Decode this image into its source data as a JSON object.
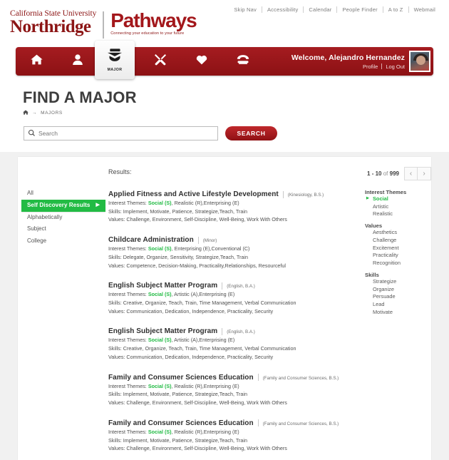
{
  "utility_nav": [
    {
      "label": "Skip Nav"
    },
    {
      "label": "Accessibility"
    },
    {
      "label": "Calendar"
    },
    {
      "label": "People Finder"
    },
    {
      "label": "A to Z"
    },
    {
      "label": "Webmail"
    }
  ],
  "logo": {
    "line1": "California State University",
    "line2": "Northridge",
    "brand": "Pathways",
    "tagline": "Connecting your education to your future"
  },
  "main_nav": {
    "icons": [
      {
        "name": "home-icon",
        "label": "Home"
      },
      {
        "name": "person-icon",
        "label": "Profile"
      },
      {
        "name": "graduation-cap-icon",
        "label": "MAJOR"
      },
      {
        "name": "tools-icon",
        "label": "Tools"
      },
      {
        "name": "heart-icon",
        "label": "Favorites"
      },
      {
        "name": "phone-icon",
        "label": "Contact"
      }
    ],
    "active_tab_label": "MAJOR",
    "welcome": "Welcome,  Alejandro Hernandez",
    "profile_link": "Profile",
    "logout_link": "Log Out"
  },
  "page": {
    "title": "FIND A MAJOR",
    "breadcrumb_home_icon": "home-icon",
    "breadcrumb_arrow": "→",
    "breadcrumb_current": "MAJORS"
  },
  "search": {
    "placeholder": "Search",
    "value": "",
    "button_label": "SEARCH",
    "icon": "search-icon"
  },
  "filters": {
    "items": [
      {
        "label": "All",
        "selected": false
      },
      {
        "label": "Self Discovery Results",
        "selected": true
      },
      {
        "label": "Alphabetically",
        "selected": false
      },
      {
        "label": "Subject",
        "selected": false
      },
      {
        "label": "College",
        "selected": false
      }
    ],
    "selected_caret": "▶"
  },
  "results": {
    "label": "Results:",
    "pagination": {
      "range": "1 - 10",
      "of": "of",
      "total": "999",
      "prev_icon": "chevron-left-icon",
      "next_icon": "chevron-right-icon",
      "prev_glyph": "‹",
      "next_glyph": "›"
    },
    "items": [
      {
        "title": "Applied Fitness and Active Lifestyle Development",
        "subtitle": "(Kinesiology, B.S.)",
        "themes_label": "Interest Themes:",
        "theme_highlight": "Social (S)",
        "themes_rest": ", Realistic (R),Enterprising (E)",
        "skills": "Skills: Implement,  Motivate, Patience,  Strategize,Teach, Train",
        "values": "Values:  Challenge, Environment, Self-Discipline, Well-Being, Work With Others"
      },
      {
        "title": "Childcare Administration",
        "subtitle": "(Minor)",
        "themes_label": "Interest Themes:",
        "theme_highlight": "Social (S)",
        "themes_rest": ", Enterprising (E),Conventional (C)",
        "skills": "Skills: Delegate,  Organize, Sensitivity,  Strategize,Teach, Train",
        "values": "Values: Competence, Decision-Making,  Practicality,Relationships, Resourceful"
      },
      {
        "title": "English Subject Matter Program",
        "subtitle": "(English, B.A.)",
        "themes_label": "Interest Themes:",
        "theme_highlight": "Social (S)",
        "themes_rest": ", Artistic (A),Enterprising (E)",
        "skills": "Skills: Creative,  Organize, Teach, Train, Time Management, Verbal Communication",
        "values": "Values: Communication, Dedication, Independence, Practicality, Security"
      },
      {
        "title": "English Subject Matter Program",
        "subtitle": "(English, B.A.)",
        "themes_label": "Interest Themes:",
        "theme_highlight": "Social (S)",
        "themes_rest": ", Artistic (A),Enterprising (E)",
        "skills": "Skills: Creative,  Organize, Teach, Train, Time Management, Verbal Communication",
        "values": "Values: Communication, Dedication, Independence, Practicality, Security"
      },
      {
        "title": "Family and Consumer Sciences Education",
        "subtitle": "(Family and Consumer Sciences, B.S.)",
        "themes_label": "Interest Themes:",
        "theme_highlight": "Social (S)",
        "themes_rest": ", Realistic (R),Enterprising (E)",
        "skills": "Skills: Implement,  Motivate, Patience,  Strategize,Teach, Train",
        "values": "Values:  Challenge, Environment, Self-Discipline, Well-Being, Work With Others"
      },
      {
        "title": "Family and Consumer Sciences Education",
        "subtitle": "(Family and Consumer Sciences, B.S.)",
        "themes_label": "Interest Themes:",
        "theme_highlight": "Social (S)",
        "themes_rest": ", Realistic (R),Enterprising (E)",
        "skills": "Skills: Implement,  Motivate, Patience,  Strategize,Teach, Train",
        "values": "Values:  Challenge, Environment, Self-Discipline, Well-Being, Work With Others"
      }
    ]
  },
  "right_rail": {
    "groups": [
      {
        "heading": "Interest Themes",
        "items": [
          {
            "label": "Social",
            "active": true
          },
          {
            "label": "Artistic",
            "active": false
          },
          {
            "label": "Realistic",
            "active": false
          }
        ]
      },
      {
        "heading": "Values",
        "items": [
          {
            "label": "Aesthetics",
            "active": false
          },
          {
            "label": "Challenge",
            "active": false
          },
          {
            "label": "Excitement",
            "active": false
          },
          {
            "label": "Practicality",
            "active": false
          },
          {
            "label": "Recognition",
            "active": false
          }
        ]
      },
      {
        "heading": "Skills",
        "items": [
          {
            "label": "Strategize",
            "active": false
          },
          {
            "label": "Organize",
            "active": false
          },
          {
            "label": "Persuade",
            "active": false
          },
          {
            "label": "Lead",
            "active": false
          },
          {
            "label": "Motivate",
            "active": false
          }
        ]
      }
    ]
  },
  "colors": {
    "brand_red": "#a51c20",
    "brand_dark_red": "#8c1114",
    "accent_green": "#22bb44",
    "panel_grey": "#f1f1f1"
  }
}
